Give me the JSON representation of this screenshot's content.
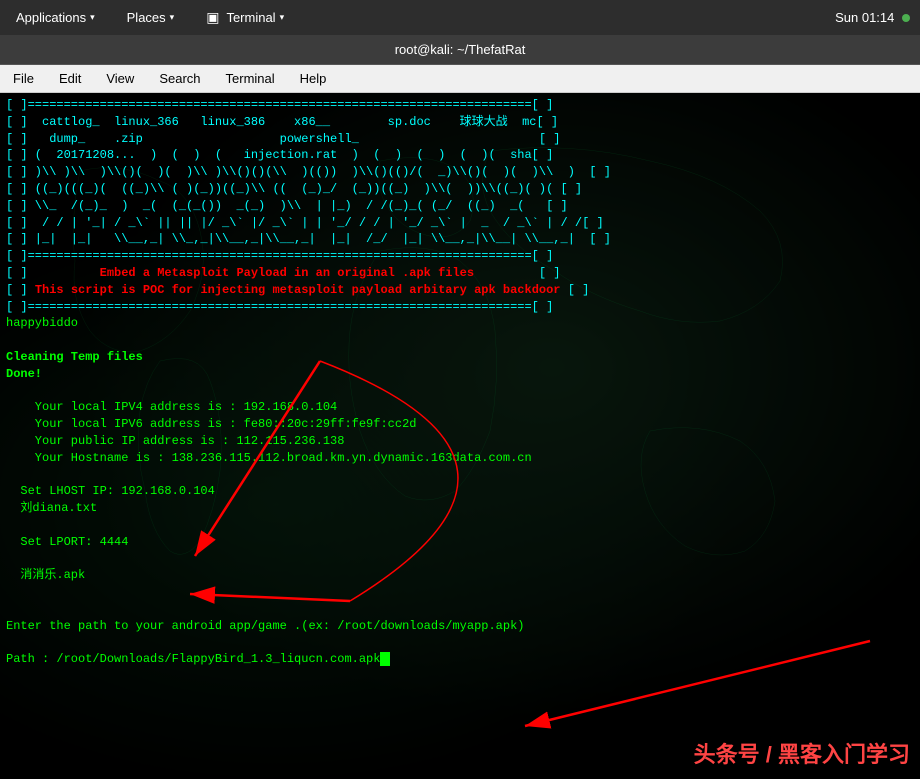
{
  "system_bar": {
    "applications_label": "Applications",
    "places_label": "Places",
    "terminal_label": "Terminal",
    "datetime": "Sun 01:14",
    "dropdown_symbol": "▾"
  },
  "title_bar": {
    "title": "root@kali: ~/ThefatRat"
  },
  "menu_bar": {
    "items": [
      "File",
      "Edit",
      "View",
      "Search",
      "Terminal",
      "Help"
    ]
  },
  "terminal": {
    "ascii_art_lines": [
      "[ ]======================================================================[ ]",
      "[ ]  cattlog_  linux_366   linux_386    x86__        sp.doc    球球大战  mc[ ]",
      "[ ]   dump_    .zip                   powershell_                       [ ]",
      "[ ] (  20171208...  )  (  )  (   injection.rat  )  (  )  (  )  (  )(  sha[ ]",
      "[ ] )\\ )\\  )\\()(  )(  )\\ )\\()()(\\  )(())  )\\()(()/(  _)\\()(  )(  )\\  )[ ]",
      "[ ] ((_)(((_)(  ((_)\\ ( )(_))((_)\\ ((  (_)_/  (_))((_)  )\\(  ))\\((_)( )((_)( [ ]",
      "[ ] \\_ /(_)_  )  _(_ (_(_())  _(_)  )\\  | |_)  / /(_)_( (_/  ((_)  _( )(_))[ ]",
      "[ ]  / / | '_| / _` || || |/ _` |/ _` | | '_/ / / | '_/ _` |  _  / _` |  / /[ ]",
      "[ ] |_|  |_|   \\__,_| \\_,_|\\__,_|\\__,_|  |_|  /_/  |_| \\__,_|\\__| \\__,_|  [ ]",
      "[ ]======================================================================[ ]",
      "[ ]          Embed a Metasploit Payload in an original .apk files         [ ]",
      "[ ] This script is POC for injecting metasploit payload arbitary apk backdoor [ ]",
      "[ ]======================================================================[ ]"
    ],
    "status_lines": [
      "happybiddo",
      "",
      "Cleaning Temp files",
      "Done!",
      "",
      "    Your local IPV4 address is : 192.168.0.104",
      "    Your local IPV6 address is : fe80::20c:29ff:fe9f:cc2d",
      "    Your public IP address is : 112.115.236.138",
      "    Your Hostname is : 138.236.115.112.broad.km.yn.dynamic.163data.com.cn",
      "",
      "  Set LHOST IP: 192.168.0.104",
      "  刘diana.txt",
      "",
      "  Set LPORT: 4444",
      "",
      "  消消乐.apk",
      "",
      "",
      "Enter the path to your android app/game .(ex: /root/downloads/myapp.apk)",
      "",
      "Path : /root/Downloads/FlappyBird_1.3_liqucn.com.apk"
    ]
  },
  "watermark": {
    "text": "头条号 / 黑客入门学习"
  }
}
